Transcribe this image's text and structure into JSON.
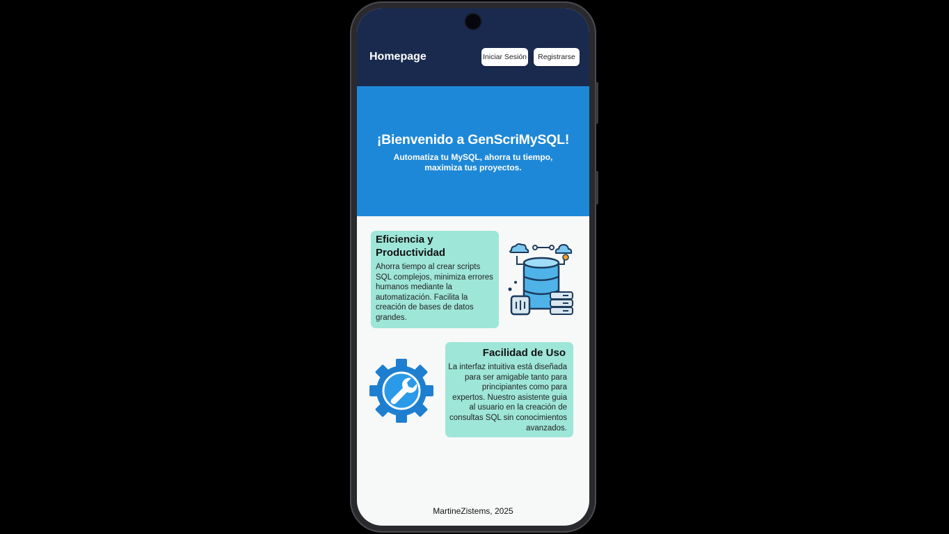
{
  "app": {
    "brand": "Homepage",
    "login_label": "Iniciar Sesión",
    "register_label": "Registrarse"
  },
  "hero": {
    "title": "¡Bienvenido a GenScriMySQL!",
    "subtitle": "Automatiza tu MySQL, ahorra tu tiempo, maximiza tus proyectos."
  },
  "features": [
    {
      "title": "Eficiencia y Productividad",
      "text": "Ahorra tiempo al crear scripts SQL complejos, minimiza errores humanos mediante la automatización. Facilita la creación de bases de datos grandes.",
      "icon": "database-server-icon"
    },
    {
      "title": "Facilidad de Uso",
      "text": "La interfaz intuitiva está diseñada para ser amigable tanto para principiantes como para expertos. Nuestro asistente guia al usuario en la creación de consultas SQL sin conocimientos avanzados.",
      "icon": "gear-wrench-icon"
    }
  ],
  "footer": {
    "text": "MartineZistems, 2025"
  },
  "colors": {
    "appbar": "#1a2a4f",
    "hero": "#1e88d8",
    "card": "#9ee6d8",
    "background": "#f7f8f8"
  }
}
